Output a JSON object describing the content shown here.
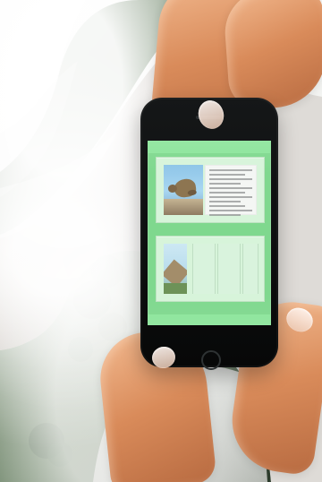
{
  "scene": {
    "colors": {
      "sky": "#f6f6f4",
      "cliff": "#a39a8e",
      "forest": "#355b2f",
      "phone": "#0d0e0f",
      "screen": "#7fd88e",
      "skin": "#d98b5a"
    }
  }
}
